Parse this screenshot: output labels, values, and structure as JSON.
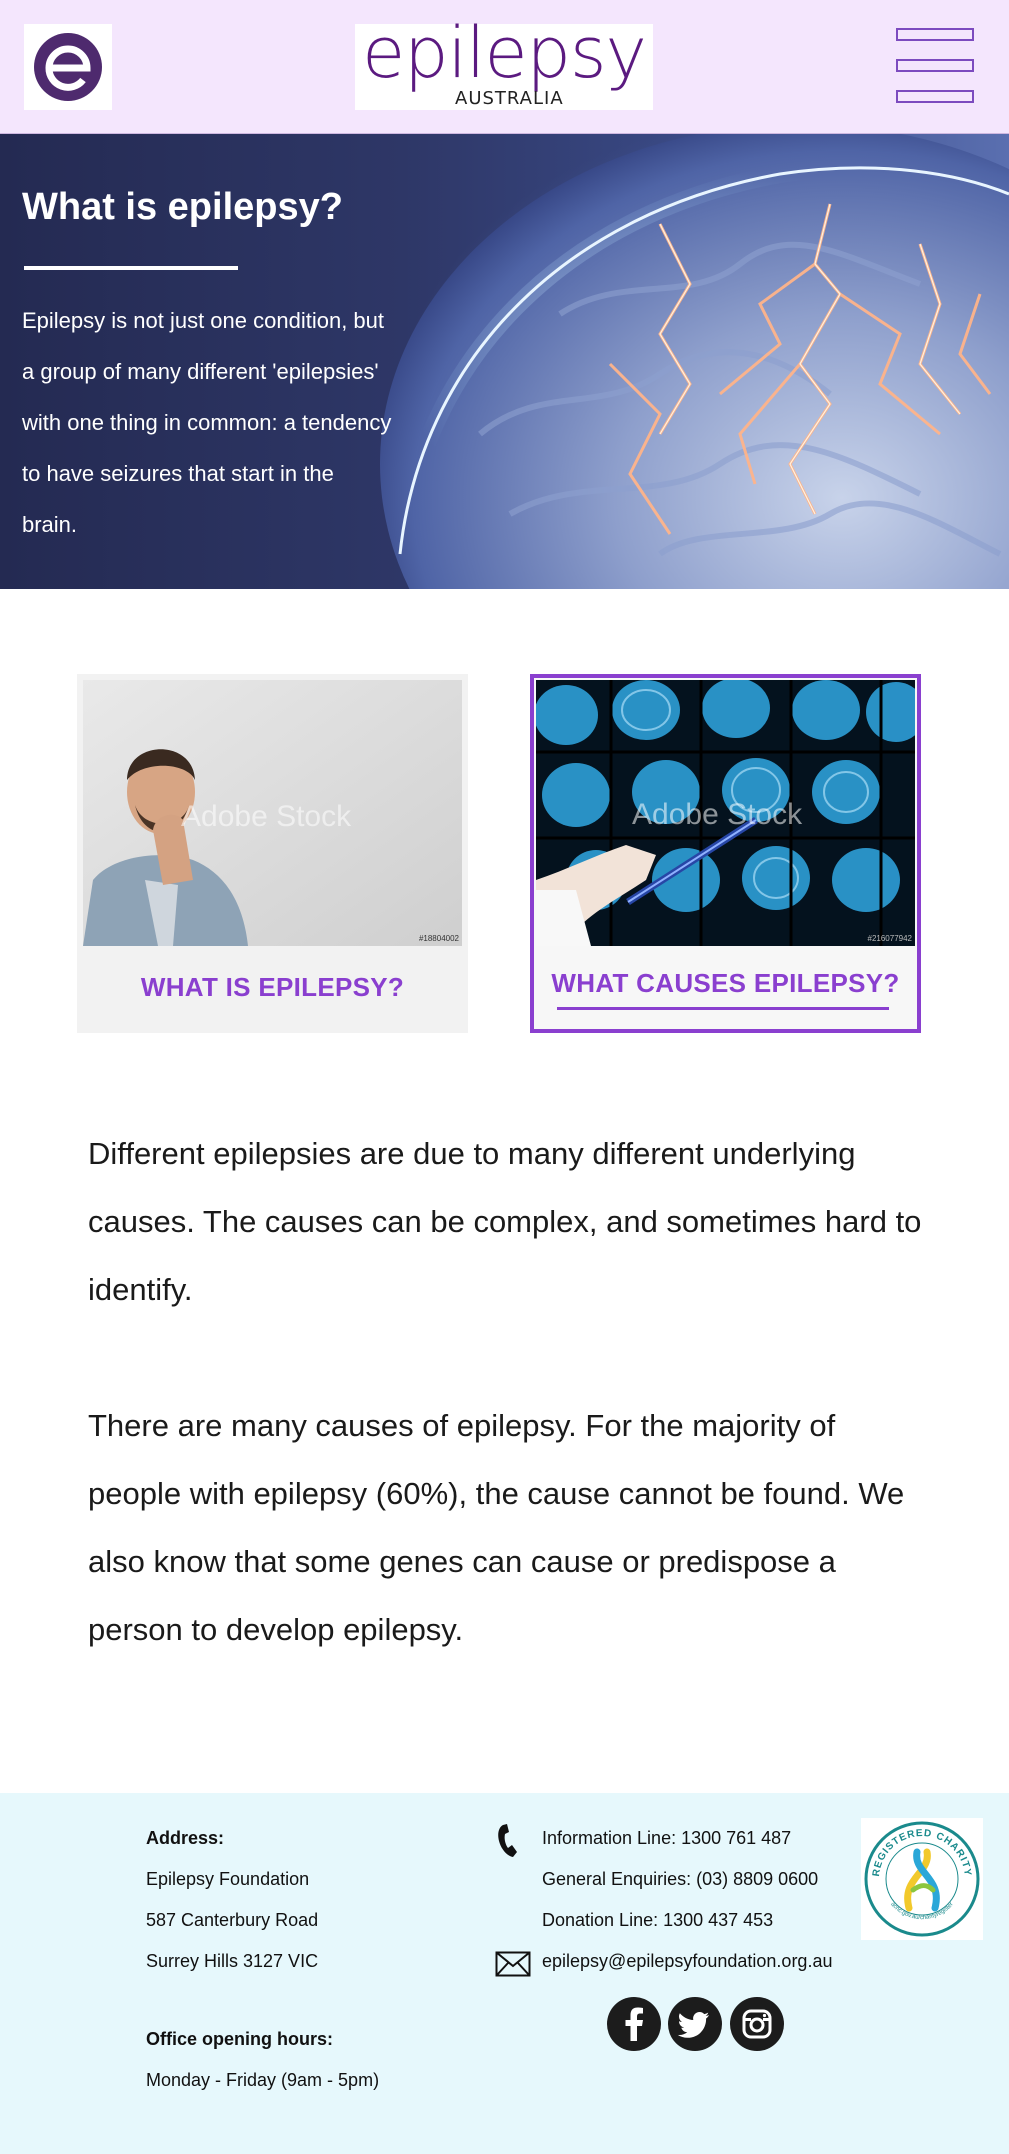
{
  "header": {
    "logo_alt": "e",
    "brand_name": "epilepsy",
    "brand_sub": "AUSTRALIA",
    "menu_icon": "hamburger-menu-icon"
  },
  "hero": {
    "title": "What is epilepsy?",
    "text": "Epilepsy is not just one condition, but a group of many different 'epilepsies' with one thing in common: a tendency to have seizures that start in the brain."
  },
  "cards": [
    {
      "label": "WHAT IS EPILEPSY?",
      "watermark": "Adobe Stock",
      "stock_no": "#18804002"
    },
    {
      "label": "WHAT CAUSES EPILEPSY?",
      "watermark": "Adobe Stock",
      "stock_no": "#216077942"
    }
  ],
  "content": {
    "paragraph_1": "Different epilepsies are due to many different underlying causes. The causes can be complex, and sometimes hard to identify.",
    "paragraph_2": "There are many causes of epilepsy.  For the majority of people with epilepsy (60%), the cause cannot be found. We also know that some genes can cause or predispose a person to develop epilepsy."
  },
  "footer": {
    "address_heading": "Address:",
    "address_line_1": "Epilepsy Foundation",
    "address_line_2": "587 Canterbury Road",
    "address_line_3": "Surrey Hills 3127 VIC",
    "hours_heading": "Office opening hours:",
    "hours": "Monday - Friday (9am - 5pm)",
    "info_line": "Information Line: 1300 761 487",
    "general_enquiries": "General Enquiries: (03) 8809 0600",
    "donation_line": "Donation Line: 1300 437 453",
    "email": "epilepsy@epilepsyfoundation.org.au",
    "charity_badge_top": "REGISTERED CHARITY",
    "charity_badge_bottom": "acnc.gov.au/charityregister",
    "social": [
      "facebook-icon",
      "twitter-icon",
      "instagram-icon"
    ]
  },
  "colors": {
    "header_bg": "#f4e6fd",
    "brand_purple": "#5b1a80",
    "accent_purple": "#8a3fcf",
    "footer_bg": "#e6f8fc"
  }
}
